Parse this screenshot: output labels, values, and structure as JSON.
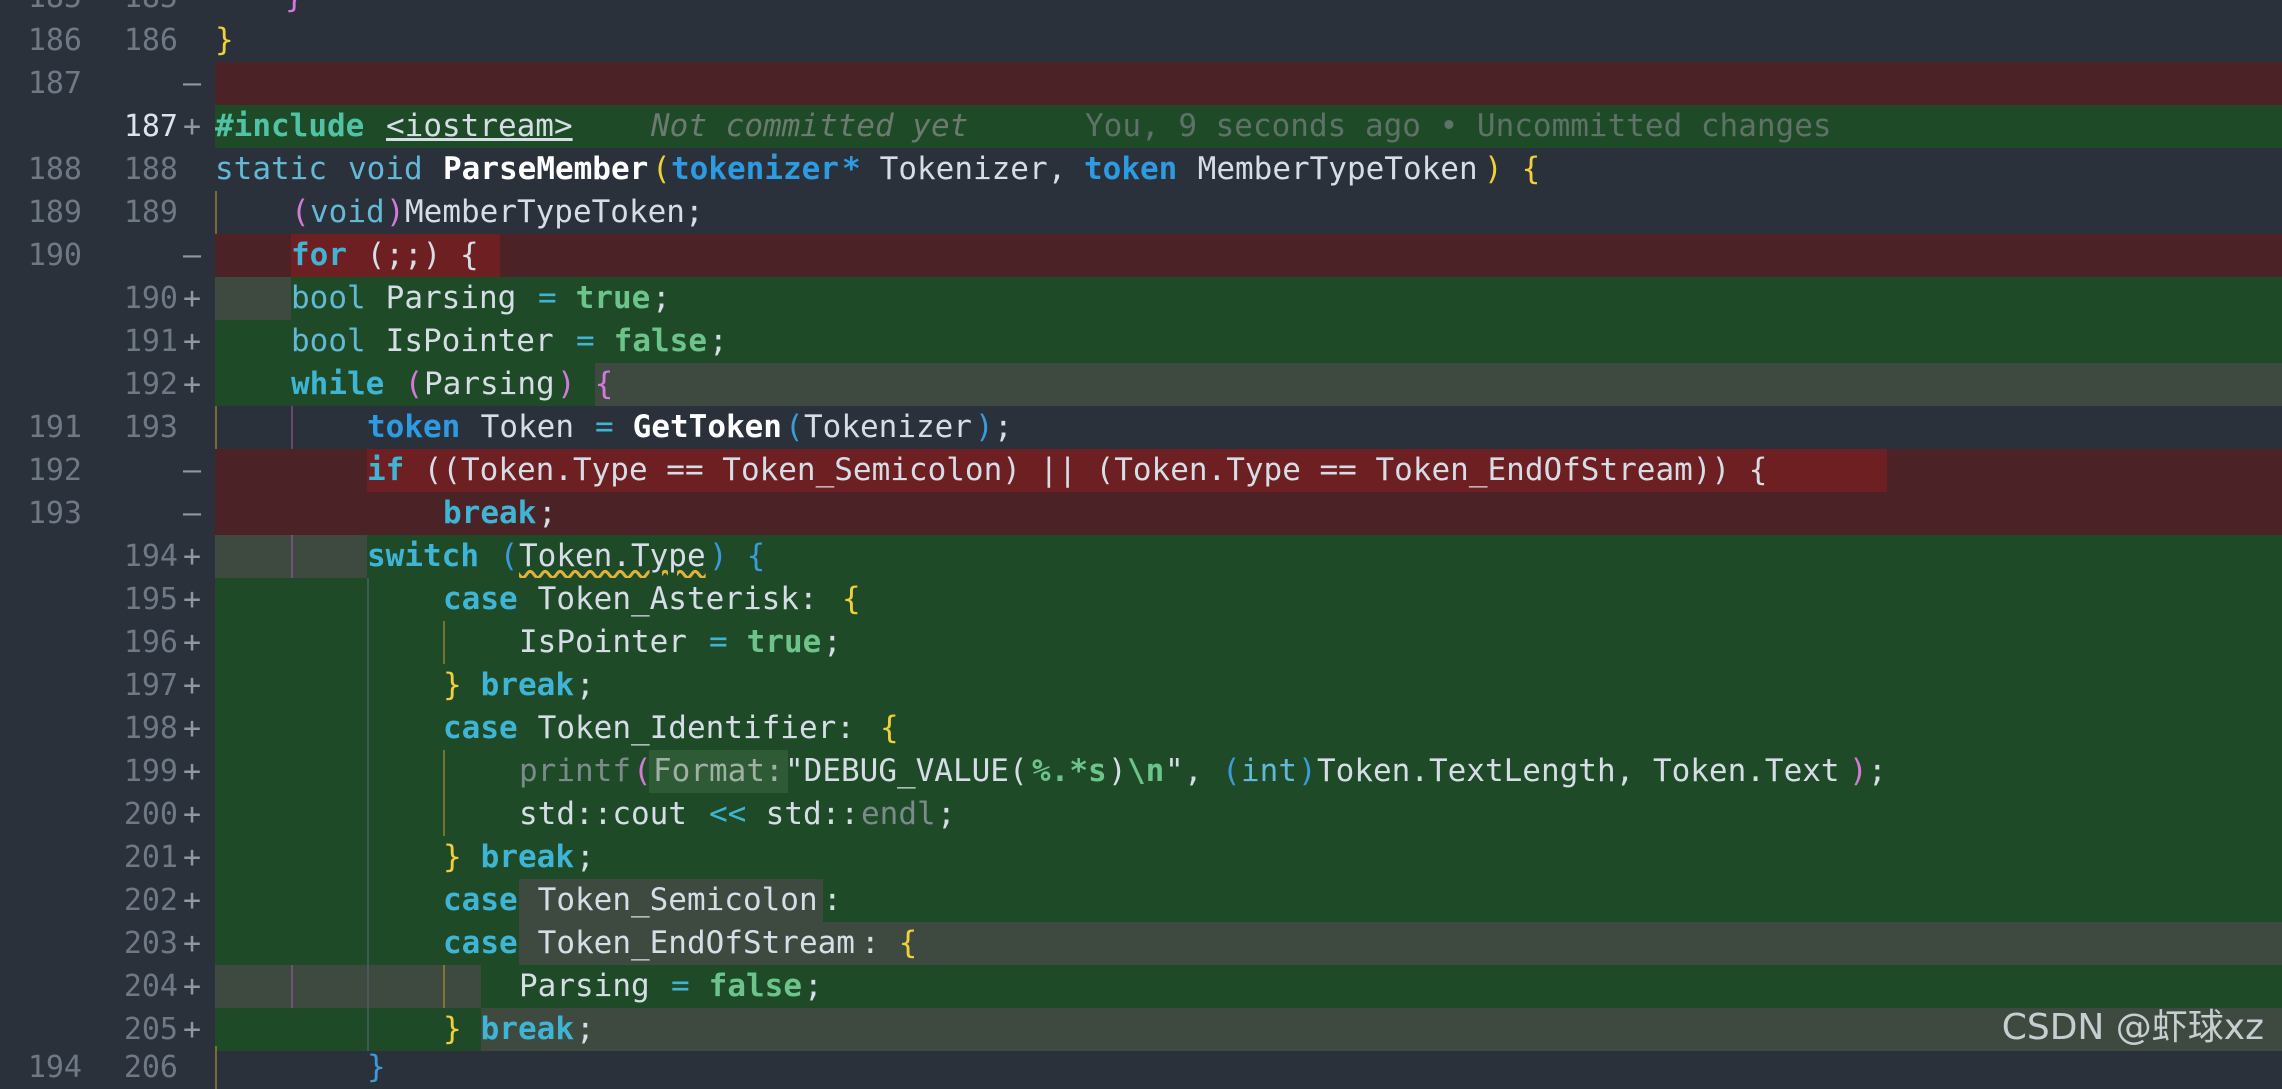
{
  "editor": {
    "rows": [
      {
        "old": "185",
        "new": "185",
        "type": "ctx",
        "mark": "",
        "line": "partial-top"
      },
      {
        "old": "186",
        "new": "186",
        "type": "ctx",
        "mark": ""
      },
      {
        "old": "187",
        "new": "",
        "type": "del",
        "mark": "—"
      },
      {
        "old": "",
        "new": "187",
        "type": "add",
        "mark": "+",
        "current": true
      },
      {
        "old": "188",
        "new": "188",
        "type": "ctx",
        "mark": ""
      },
      {
        "old": "189",
        "new": "189",
        "type": "ctx",
        "mark": ""
      },
      {
        "old": "190",
        "new": "",
        "type": "del",
        "mark": "—"
      },
      {
        "old": "",
        "new": "190",
        "type": "add",
        "mark": "+"
      },
      {
        "old": "",
        "new": "191",
        "type": "add",
        "mark": "+"
      },
      {
        "old": "",
        "new": "192",
        "type": "add",
        "mark": "+"
      },
      {
        "old": "191",
        "new": "193",
        "type": "ctx",
        "mark": ""
      },
      {
        "old": "192",
        "new": "",
        "type": "del",
        "mark": "—"
      },
      {
        "old": "193",
        "new": "",
        "type": "del",
        "mark": "—"
      },
      {
        "old": "",
        "new": "194",
        "type": "add",
        "mark": "+"
      },
      {
        "old": "",
        "new": "195",
        "type": "add",
        "mark": "+"
      },
      {
        "old": "",
        "new": "196",
        "type": "add",
        "mark": "+"
      },
      {
        "old": "",
        "new": "197",
        "type": "add",
        "mark": "+"
      },
      {
        "old": "",
        "new": "198",
        "type": "add",
        "mark": "+"
      },
      {
        "old": "",
        "new": "199",
        "type": "add",
        "mark": "+"
      },
      {
        "old": "",
        "new": "200",
        "type": "add",
        "mark": "+"
      },
      {
        "old": "",
        "new": "201",
        "type": "add",
        "mark": "+"
      },
      {
        "old": "",
        "new": "202",
        "type": "add",
        "mark": "+"
      },
      {
        "old": "",
        "new": "203",
        "type": "add",
        "mark": "+"
      },
      {
        "old": "",
        "new": "204",
        "type": "add",
        "mark": "+"
      },
      {
        "old": "",
        "new": "205",
        "type": "add",
        "mark": "+"
      },
      {
        "old": "194",
        "new": "206",
        "type": "ctx",
        "mark": ""
      }
    ],
    "code": {
      "l186_brace": "}",
      "l187_include": "#include",
      "l187_header": "<iostream>",
      "l187_ghost": "Not committed yet",
      "l187_blame": "You, 9 seconds ago • Uncommitted changes",
      "l188_static": "static",
      "l188_void": "void",
      "l188_fn": "ParseMember",
      "l188_open": "(",
      "l188_tokenizer": "tokenizer",
      "l188_star": "*",
      "l188_p1": " Tokenizer, ",
      "l188_token": "token",
      "l188_p2": " MemberTypeToken",
      "l188_close": ")",
      "l188_brace": " {",
      "l189_open": "(",
      "l189_void": "void",
      "l189_close": ")",
      "l189_rest": "MemberTypeToken;",
      "l190_for": "for",
      "l190_rest": " (;;) {",
      "l190n_bool": "bool",
      "l190n_name": " Parsing ",
      "l190n_eq": "=",
      "l190n_true": " true",
      "l190n_semi": ";",
      "l191_bool": "bool",
      "l191_name": " IsPointer ",
      "l191_eq": "=",
      "l191_false": " false",
      "l191_semi": ";",
      "l192_while": "while",
      "l192_open": " (",
      "l192_cond": "Parsing",
      "l192_close": ")",
      "l192_brace": " {",
      "l193_token": "token",
      "l193_name": " Token ",
      "l193_eq": "=",
      "l193_fn": " GetToken",
      "l193_open": "(",
      "l193_arg": "Tokenizer",
      "l193_close": ")",
      "l193_semi": ";",
      "ld192_if": "if",
      "ld192_rest": " ((Token.Type == Token_Semicolon) || (Token.Type == Token_EndOfStream)) {",
      "ld193_break": "break",
      "ld193_semi": ";",
      "l194_switch": "switch",
      "l194_open": " (",
      "l194_cond": "Token.Type",
      "l194_close": ")",
      "l194_brace": " {",
      "l195_case": "case",
      "l195_label": " Token_Asterisk: ",
      "l195_brace": "{",
      "l196_name": "IsPointer ",
      "l196_eq": "=",
      "l196_true": " true",
      "l196_semi": ";",
      "l197_brace": "}",
      "l197_break": " break",
      "l197_semi": ";",
      "l198_case": "case",
      "l198_label": " Token_Identifier: ",
      "l198_brace": "{",
      "l199_fn": "printf",
      "l199_open": "(",
      "l199_hint": "Format:",
      "l199_str1": "\"DEBUG_VALUE(",
      "l199_fmt": "%.*s",
      "l199_str2": ")",
      "l199_esc": "\\n",
      "l199_str3": "\"",
      "l199_comma": ", ",
      "l199_cast_open": "(",
      "l199_int": "int",
      "l199_cast_close": ")",
      "l199_rest": "Token.TextLength, Token.Text",
      "l199_close": ")",
      "l199_semi": ";",
      "l200_std": "std::cout ",
      "l200_op": "<<",
      "l200_std2": " std::",
      "l200_endl": "endl",
      "l200_semi": ";",
      "l201_brace": "}",
      "l201_break": " break",
      "l201_semi": ";",
      "l202_case": "case",
      "l202_label": " Token_Semicolon",
      "l202_colon": ":",
      "l203_case": "case",
      "l203_label": " Token_EndOfStream",
      "l203_colon": ":",
      "l203_brace": " {",
      "l204_name": "Parsing ",
      "l204_eq": "=",
      "l204_false": " false",
      "l204_semi": ";",
      "l205_brace": "}",
      "l205_break": " break",
      "l205_semi": ";",
      "l206_brace": "}"
    }
  },
  "watermark": "CSDN @虾球xz",
  "colors": {
    "background": "#2b313b",
    "deleted_line": "#4b2326",
    "added_line": "#1f4a28",
    "keyword": "#3fb4d4",
    "type": "#2d9be2",
    "bracket_yellow": "#f0cf3a",
    "bracket_pink": "#d27ad8"
  }
}
